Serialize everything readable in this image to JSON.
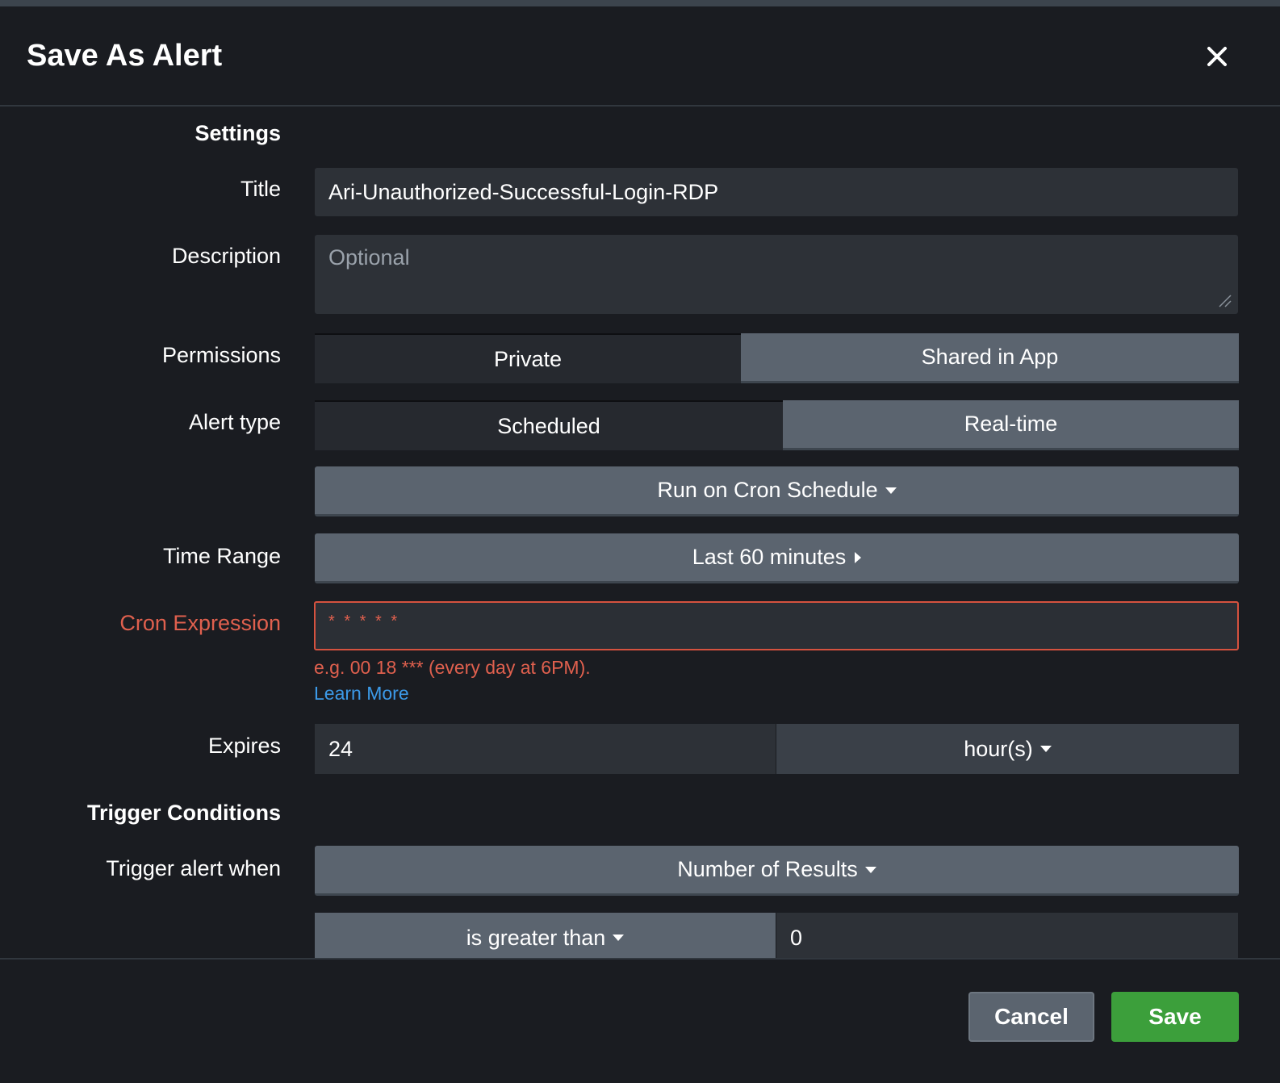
{
  "dialog": {
    "title": "Save As Alert"
  },
  "settings": {
    "section_label": "Settings",
    "title_label": "Title",
    "title_value": "Ari-Unauthorized-Successful-Login-RDP",
    "description_label": "Description",
    "description_placeholder": "Optional",
    "permissions_label": "Permissions",
    "permissions_options": [
      "Private",
      "Shared in App"
    ],
    "permissions_selected": "Shared in App",
    "alert_type_label": "Alert type",
    "alert_type_options": [
      "Scheduled",
      "Real-time"
    ],
    "alert_type_selected": "Real-time",
    "schedule_dropdown": "Run on Cron Schedule",
    "time_range_label": "Time Range",
    "time_range_value": "Last 60 minutes",
    "cron_label": "Cron Expression",
    "cron_value": "* * * * *",
    "cron_help": "e.g. 00 18 *** (every day at 6PM).",
    "learn_more": "Learn More",
    "expires_label": "Expires",
    "expires_value": "24",
    "expires_unit": "hour(s)"
  },
  "trigger": {
    "section_label": "Trigger Conditions",
    "trigger_when_label": "Trigger alert when",
    "trigger_when_value": "Number of Results",
    "comparison_value": "is greater than",
    "threshold_value": "0"
  },
  "footer": {
    "cancel_label": "Cancel",
    "save_label": "Save"
  },
  "colors": {
    "background": "#1a1c21",
    "error": "#e0604e",
    "link": "#3c9ae8",
    "save_button": "#3c9f3b",
    "selected_toggle": "#5b646f"
  }
}
